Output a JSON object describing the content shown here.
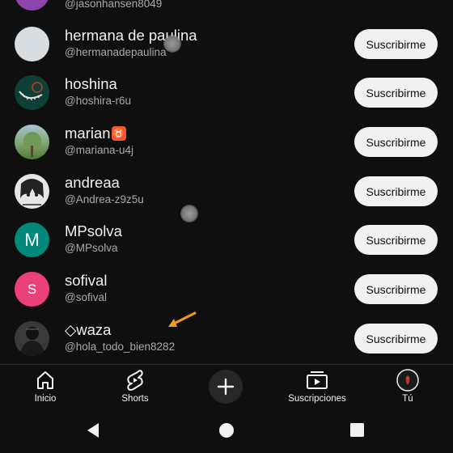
{
  "channels": [
    {
      "name": "",
      "handle": "@jasonhansen8049",
      "avatar_color": "#8e44ad",
      "subscribe_label": ""
    },
    {
      "name": "hermana de paulina",
      "handle": "@hermanadepaulina",
      "avatar_color": "#d8dde2",
      "subscribe_label": "Suscribirme"
    },
    {
      "name": "hoshina",
      "handle": "@hoshira-r6u",
      "avatar_color": "#0f4036",
      "subscribe_label": "Suscribirme"
    },
    {
      "name": "marian",
      "name_badge": "♉",
      "handle": "@mariana-u4j",
      "avatar_color": "#7fa66b",
      "subscribe_label": "Suscribirme"
    },
    {
      "name": "andreaa",
      "handle": "@Andrea-z9z5u",
      "avatar_color": "#d9d9d9",
      "subscribe_label": "Suscribirme"
    },
    {
      "name": "MPsolva",
      "handle": "@MPsolva",
      "avatar_color": "#00897b",
      "avatar_letter": "M",
      "subscribe_label": "Suscribirme"
    },
    {
      "name": "sofival",
      "handle": "@sofival",
      "avatar_color": "#ec407a",
      "avatar_letter": "S",
      "subscribe_label": "Suscribirme"
    },
    {
      "name": "◇waza",
      "handle": "@hola_todo_bien8282",
      "avatar_color": "#3a3a3a",
      "subscribe_label": "Suscribirme"
    }
  ],
  "bottom_nav": {
    "home_label": "Inicio",
    "shorts_label": "Shorts",
    "subscriptions_label": "Suscripciones",
    "you_label": "Tú"
  },
  "colors": {
    "background": "#0f0f0f",
    "subscribe_bg": "#f1f1f1",
    "accent_orange": "#f39c12"
  }
}
